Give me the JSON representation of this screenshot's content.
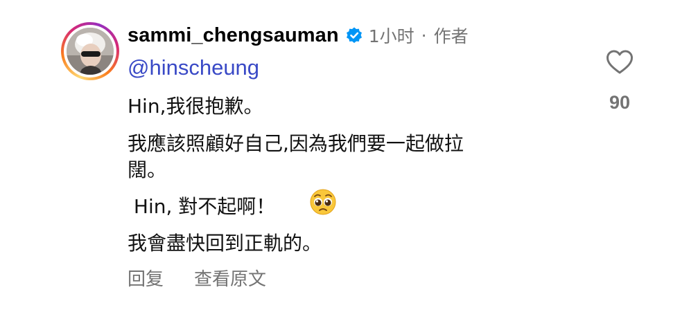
{
  "comment": {
    "username": "sammi_chengsauman",
    "verified": true,
    "time": "1小时",
    "separator": "·",
    "author_label": "作者",
    "mention": "@hinscheung",
    "lines": [
      "Hin,我很抱歉。",
      "我應該照顧好自己,因為我們要一起做拉",
      "闊。",
      " Hin, 對不起啊！",
      "我會盡快回到正軌的。"
    ],
    "emoji": "pleading-face",
    "actions": {
      "reply": "回复",
      "see_translation": "查看原文"
    },
    "likes": {
      "count": "90",
      "icon": "heart-icon"
    }
  },
  "colors": {
    "mention": "#3949c6",
    "secondary_text": "#737373",
    "verified_badge": "#0095f6",
    "text": "#111111"
  }
}
